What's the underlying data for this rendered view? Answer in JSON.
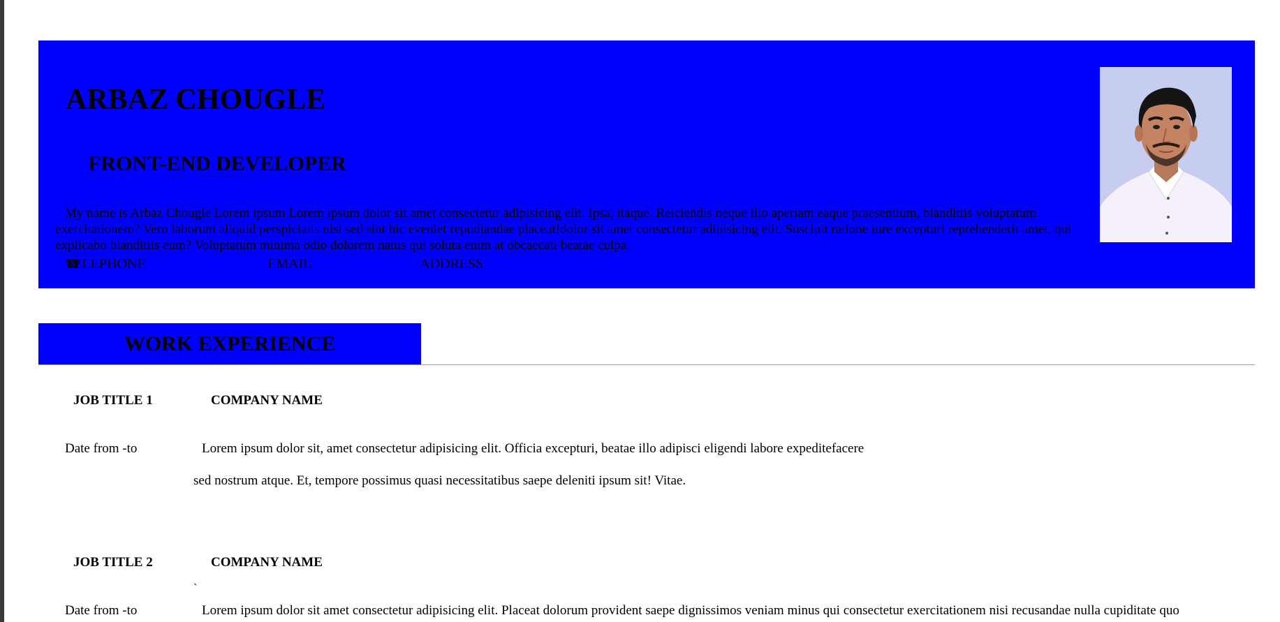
{
  "header": {
    "name": "ARBAZ CHOUGLE",
    "role": "FRONT-END DEVELOPER",
    "about": "My name is Arbaz Chougle Lorem ipsum Lorem ipsum dolor sit amet consectetur adipisicing elit. Ipsa, itaque. Reiciendis neque illo aperiam eaque praesentium, blanditiis voluptatum exercitationem? Vero laborum aliquid perspiciatis nisi sed sint hic eveniet repudiandae placeat!dolor sit amet consectetur adipisicing elit. Suscipit ratione iure excepturi reprehenderit amet, qui explicabo blanditiis eum? Voluptatum minima odio dolorem natus qui soluta enim at obcaecati beatae culpa.",
    "contacts": {
      "telephone_icon": "☎",
      "telephone": "TELEPHONE",
      "email": "EMAIL",
      "address": "ADDRESS"
    },
    "colors": {
      "accent": "#0000ff",
      "photo_bg": "#c6cdf0"
    }
  },
  "work_experience": {
    "heading": "WORK EXPERIENCE",
    "jobs": [
      {
        "title": "JOB TITLE 1",
        "company": "COMPANY NAME",
        "date": "Date from -to",
        "desc_line1": "Lorem ipsum dolor sit, amet consectetur adipisicing elit. Officia excepturi, beatae illo adipisci eligendi labore expeditefacere",
        "desc_line2": "sed nostrum atque. Et, tempore possimus quasi necessitatibus saepe deleniti ipsum sit! Vitae."
      },
      {
        "title": "JOB TITLE 2",
        "company": "COMPANY NAME",
        "mark": "`",
        "date": "Date from -to",
        "desc_line1": "Lorem ipsum dolor sit amet consectetur adipisicing elit. Placeat dolorum provident saepe dignissimos veniam minus qui consectetur exercitationem nisi recusandae nulla cupiditate quo"
      }
    ]
  }
}
